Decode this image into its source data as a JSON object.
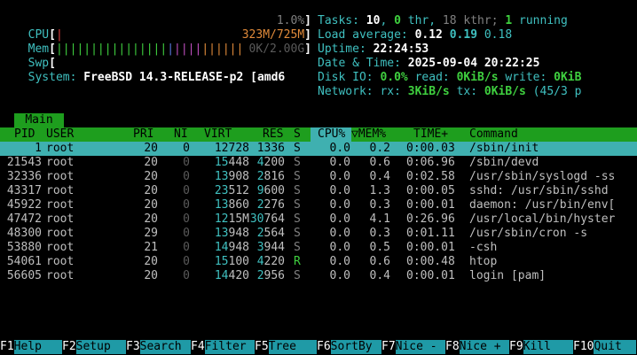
{
  "meters": {
    "cpu": {
      "label": "CPU",
      "bar": "|",
      "value": "1.0%"
    },
    "mem": {
      "label": "Mem",
      "bar_green": "||||||||||||||||",
      "bar_blue": "|",
      "bar_magenta": "||||",
      "bar_orange": "||||||",
      "value": "323M/725M"
    },
    "swp": {
      "label": "Swp",
      "value": "0K/2.00G"
    },
    "system": {
      "label": "System:",
      "value": "FreeBSD 14.3-RELEASE-p2 [amd6"
    }
  },
  "stats": {
    "tasks_label": "Tasks:",
    "tasks": "10",
    "thr": "0",
    "thr_label": "thr,",
    "kthr": "18 kthr;",
    "running": "1",
    "running_label": "running",
    "load_label": "Load average:",
    "load1": "0.12",
    "load5": "0.19",
    "load15": "0.18",
    "uptime_label": "Uptime:",
    "uptime": "22:24:53",
    "datetime_label": "Date & Time:",
    "datetime": "2025-09-04 20:22:25",
    "disk_label": "Disk IO:",
    "disk_pct": "0.0%",
    "disk_read_label": "read:",
    "disk_read": "0KiB/s",
    "disk_write_label": "write:",
    "disk_write": "0KiB",
    "net_label": "Network:",
    "net_rx_label": "rx:",
    "net_rx": "3KiB/s",
    "net_tx_label": "tx:",
    "net_tx": "0KiB/s",
    "net_pkts": "(45/3 p"
  },
  "tab": {
    "label": "Main"
  },
  "columns": [
    "PID",
    "USER",
    "PRI",
    "NI",
    "VIRT",
    "RES",
    "S",
    "CPU%",
    "▽MEM%",
    "TIME+",
    "Command"
  ],
  "processes": [
    {
      "pid": "1",
      "user": "root",
      "pri": "20",
      "ni": "0",
      "virt": "12728",
      "res": "1336",
      "s": "S",
      "cpu": "0.0",
      "mem": "0.2",
      "time": "0:00.03",
      "cmd": "/sbin/init"
    },
    {
      "pid": "21543",
      "user": "root",
      "pri": "20",
      "ni": "0",
      "virt": "15448",
      "res": "4200",
      "s": "S",
      "cpu": "0.0",
      "mem": "0.6",
      "time": "0:06.96",
      "cmd": "/sbin/devd"
    },
    {
      "pid": "32336",
      "user": "root",
      "pri": "20",
      "ni": "0",
      "virt": "13908",
      "res": "2816",
      "s": "S",
      "cpu": "0.0",
      "mem": "0.4",
      "time": "0:02.58",
      "cmd": "/usr/sbin/syslogd -ss"
    },
    {
      "pid": "43317",
      "user": "root",
      "pri": "20",
      "ni": "0",
      "virt": "23512",
      "res": "9600",
      "s": "S",
      "cpu": "0.0",
      "mem": "1.3",
      "time": "0:00.05",
      "cmd": "sshd: /usr/sbin/sshd"
    },
    {
      "pid": "45922",
      "user": "root",
      "pri": "20",
      "ni": "0",
      "virt": "13860",
      "res": "2276",
      "s": "S",
      "cpu": "0.0",
      "mem": "0.3",
      "time": "0:00.01",
      "cmd": "daemon: /usr/bin/env["
    },
    {
      "pid": "47472",
      "user": "root",
      "pri": "20",
      "ni": "0",
      "virt": "1215M",
      "res": "30764",
      "s": "S",
      "cpu": "0.0",
      "mem": "4.1",
      "time": "0:26.96",
      "cmd": "/usr/local/bin/hyster"
    },
    {
      "pid": "48300",
      "user": "root",
      "pri": "29",
      "ni": "0",
      "virt": "13948",
      "res": "2564",
      "s": "S",
      "cpu": "0.0",
      "mem": "0.3",
      "time": "0:01.11",
      "cmd": "/usr/sbin/cron -s"
    },
    {
      "pid": "53880",
      "user": "root",
      "pri": "21",
      "ni": "0",
      "virt": "14948",
      "res": "3944",
      "s": "S",
      "cpu": "0.0",
      "mem": "0.5",
      "time": "0:00.01",
      "cmd": "-csh"
    },
    {
      "pid": "54061",
      "user": "root",
      "pri": "20",
      "ni": "0",
      "virt": "15100",
      "res": "4220",
      "s": "R",
      "cpu": "0.0",
      "mem": "0.6",
      "time": "0:00.48",
      "cmd": "htop"
    },
    {
      "pid": "56605",
      "user": "root",
      "pri": "20",
      "ni": "0",
      "virt": "14420",
      "res": "2956",
      "s": "S",
      "cpu": "0.0",
      "mem": "0.4",
      "time": "0:00.01",
      "cmd": "login [pam]"
    }
  ],
  "fkeys": [
    {
      "key": "F1",
      "label": "Help"
    },
    {
      "key": "F2",
      "label": "Setup"
    },
    {
      "key": "F3",
      "label": "Search"
    },
    {
      "key": "F4",
      "label": "Filter"
    },
    {
      "key": "F5",
      "label": "Tree"
    },
    {
      "key": "F6",
      "label": "SortBy"
    },
    {
      "key": "F7",
      "label": "Nice -"
    },
    {
      "key": "F8",
      "label": "Nice +"
    },
    {
      "key": "F9",
      "label": "Kill"
    },
    {
      "key": "F10",
      "label": "Quit"
    }
  ],
  "colors": {
    "header_bg": "#1e9e1e",
    "selected_bg": "#3fb0b0",
    "fkey_bg": "#1f9aa6",
    "label": "#3fc0c0"
  }
}
